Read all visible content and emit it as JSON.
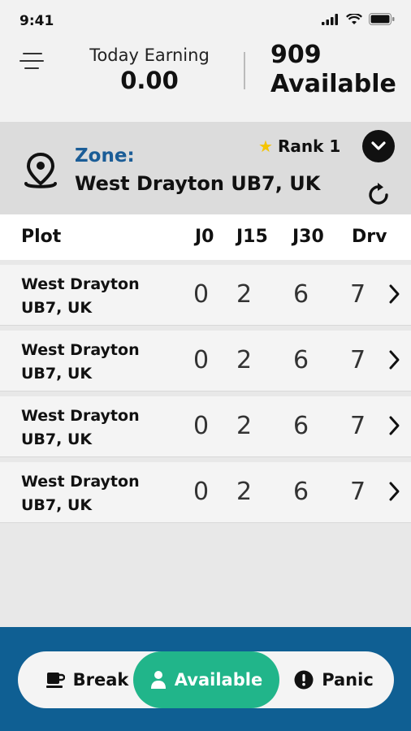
{
  "status_bar": {
    "time": "9:41"
  },
  "header": {
    "earning_label": "Today Earning",
    "earning_value": "0.00",
    "available_count": "909",
    "available_label": "Available"
  },
  "zone": {
    "title": "Zone:",
    "name": "West Drayton UB7, UK",
    "rank_label": "Rank 1"
  },
  "table": {
    "headers": [
      "Plot",
      "J0",
      "J15",
      "J30",
      "Drv"
    ],
    "rows": [
      {
        "name_line1": "West Drayton",
        "name_line2": "UB7, UK",
        "j0": "0",
        "j15": "2",
        "j30": "6",
        "drv": "7"
      },
      {
        "name_line1": "West Drayton",
        "name_line2": "UB7, UK",
        "j0": "0",
        "j15": "2",
        "j30": "6",
        "drv": "7"
      },
      {
        "name_line1": "West Drayton",
        "name_line2": "UB7, UK",
        "j0": "0",
        "j15": "2",
        "j30": "6",
        "drv": "7"
      },
      {
        "name_line1": "West Drayton",
        "name_line2": "UB7, UK",
        "j0": "0",
        "j15": "2",
        "j30": "6",
        "drv": "7"
      }
    ]
  },
  "bottom": {
    "break_label": "Break",
    "available_label": "Available",
    "panic_label": "Panic"
  },
  "colors": {
    "zone_title": "#1b5d97",
    "bottom_bar": "#0f5f93",
    "active_pill": "#21b58a",
    "star": "#f5c400"
  },
  "icons": [
    "signal-icon",
    "wifi-icon",
    "battery-icon",
    "menu-icon",
    "location-pin-icon",
    "star-icon",
    "chevron-down-icon",
    "refresh-icon",
    "chevron-right-icon",
    "coffee-icon",
    "person-icon",
    "alert-icon"
  ]
}
